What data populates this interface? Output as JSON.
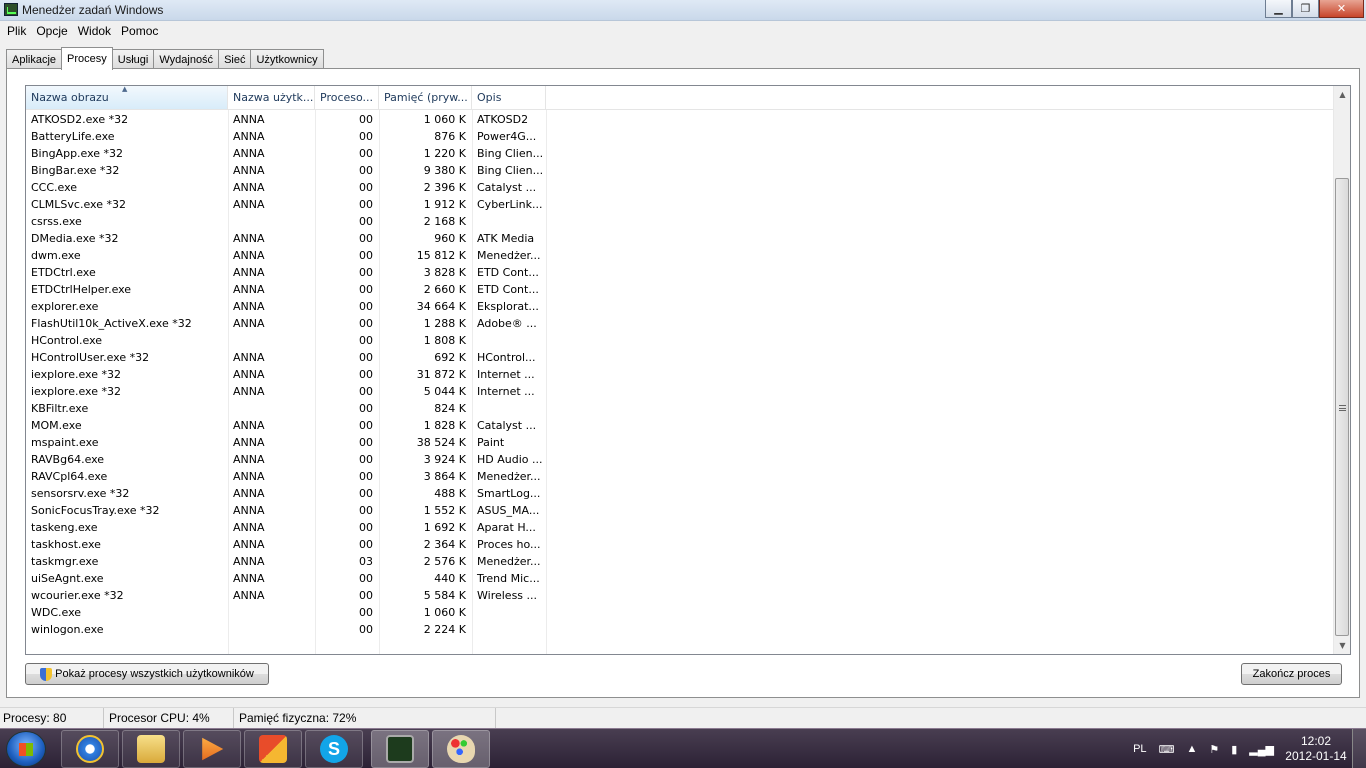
{
  "window": {
    "title": "Menedżer zadań Windows",
    "controls": {
      "minimize": "▁",
      "maximize": "❐",
      "close": "✕"
    }
  },
  "menu": [
    "Plik",
    "Opcje",
    "Widok",
    "Pomoc"
  ],
  "tabs": [
    "Aplikacje",
    "Procesy",
    "Usługi",
    "Wydajność",
    "Sieć",
    "Użytkownicy"
  ],
  "active_tab": "Procesy",
  "columns": [
    "Nazwa obrazu",
    "Nazwa użytk...",
    "Proceso...",
    "Pamięć (pryw...",
    "Opis"
  ],
  "sorted_column": "Nazwa obrazu",
  "processes": [
    {
      "name": "ATKOSD2.exe *32",
      "user": "ANNA",
      "cpu": "00",
      "mem": "1 060 K",
      "desc": "ATKOSD2"
    },
    {
      "name": "BatteryLife.exe",
      "user": "ANNA",
      "cpu": "00",
      "mem": "876 K",
      "desc": "Power4G..."
    },
    {
      "name": "BingApp.exe *32",
      "user": "ANNA",
      "cpu": "00",
      "mem": "1 220 K",
      "desc": "Bing Clien..."
    },
    {
      "name": "BingBar.exe *32",
      "user": "ANNA",
      "cpu": "00",
      "mem": "9 380 K",
      "desc": "Bing Clien..."
    },
    {
      "name": "CCC.exe",
      "user": "ANNA",
      "cpu": "00",
      "mem": "2 396 K",
      "desc": "Catalyst ..."
    },
    {
      "name": "CLMLSvc.exe *32",
      "user": "ANNA",
      "cpu": "00",
      "mem": "1 912 K",
      "desc": "CyberLink..."
    },
    {
      "name": "csrss.exe",
      "user": "",
      "cpu": "00",
      "mem": "2 168 K",
      "desc": ""
    },
    {
      "name": "DMedia.exe *32",
      "user": "ANNA",
      "cpu": "00",
      "mem": "960 K",
      "desc": "ATK Media"
    },
    {
      "name": "dwm.exe",
      "user": "ANNA",
      "cpu": "00",
      "mem": "15 812 K",
      "desc": "Menedżer..."
    },
    {
      "name": "ETDCtrl.exe",
      "user": "ANNA",
      "cpu": "00",
      "mem": "3 828 K",
      "desc": "ETD Cont..."
    },
    {
      "name": "ETDCtrlHelper.exe",
      "user": "ANNA",
      "cpu": "00",
      "mem": "2 660 K",
      "desc": "ETD Cont..."
    },
    {
      "name": "explorer.exe",
      "user": "ANNA",
      "cpu": "00",
      "mem": "34 664 K",
      "desc": "Eksplorat..."
    },
    {
      "name": "FlashUtil10k_ActiveX.exe *32",
      "user": "ANNA",
      "cpu": "00",
      "mem": "1 288 K",
      "desc": "Adobe® ..."
    },
    {
      "name": "HControl.exe",
      "user": "",
      "cpu": "00",
      "mem": "1 808 K",
      "desc": ""
    },
    {
      "name": "HControlUser.exe *32",
      "user": "ANNA",
      "cpu": "00",
      "mem": "692 K",
      "desc": "HControl..."
    },
    {
      "name": "iexplore.exe *32",
      "user": "ANNA",
      "cpu": "00",
      "mem": "31 872 K",
      "desc": "Internet ..."
    },
    {
      "name": "iexplore.exe *32",
      "user": "ANNA",
      "cpu": "00",
      "mem": "5 044 K",
      "desc": "Internet ..."
    },
    {
      "name": "KBFiltr.exe",
      "user": "",
      "cpu": "00",
      "mem": "824 K",
      "desc": ""
    },
    {
      "name": "MOM.exe",
      "user": "ANNA",
      "cpu": "00",
      "mem": "1 828 K",
      "desc": "Catalyst ..."
    },
    {
      "name": "mspaint.exe",
      "user": "ANNA",
      "cpu": "00",
      "mem": "38 524 K",
      "desc": "Paint"
    },
    {
      "name": "RAVBg64.exe",
      "user": "ANNA",
      "cpu": "00",
      "mem": "3 924 K",
      "desc": "HD Audio ..."
    },
    {
      "name": "RAVCpl64.exe",
      "user": "ANNA",
      "cpu": "00",
      "mem": "3 864 K",
      "desc": "Menedżer..."
    },
    {
      "name": "sensorsrv.exe *32",
      "user": "ANNA",
      "cpu": "00",
      "mem": "488 K",
      "desc": "SmartLog..."
    },
    {
      "name": "SonicFocusTray.exe *32",
      "user": "ANNA",
      "cpu": "00",
      "mem": "1 552 K",
      "desc": "ASUS_MA..."
    },
    {
      "name": "taskeng.exe",
      "user": "ANNA",
      "cpu": "00",
      "mem": "1 692 K",
      "desc": "Aparat H..."
    },
    {
      "name": "taskhost.exe",
      "user": "ANNA",
      "cpu": "00",
      "mem": "2 364 K",
      "desc": "Proces ho..."
    },
    {
      "name": "taskmgr.exe",
      "user": "ANNA",
      "cpu": "03",
      "mem": "2 576 K",
      "desc": "Menedżer..."
    },
    {
      "name": "uiSeAgnt.exe",
      "user": "ANNA",
      "cpu": "00",
      "mem": "440 K",
      "desc": "Trend Mic..."
    },
    {
      "name": "wcourier.exe *32",
      "user": "ANNA",
      "cpu": "00",
      "mem": "5 584 K",
      "desc": "Wireless ..."
    },
    {
      "name": "WDC.exe",
      "user": "",
      "cpu": "00",
      "mem": "1 060 K",
      "desc": ""
    },
    {
      "name": "winlogon.exe",
      "user": "",
      "cpu": "00",
      "mem": "2 224 K",
      "desc": ""
    }
  ],
  "buttons": {
    "show_all": "Pokaż procesy wszystkich użytkowników",
    "end_process": "Zakończ proces"
  },
  "status": {
    "processes": "Procesy: 80",
    "cpu": "Procesor CPU: 4%",
    "memory": "Pamięć fizyczna: 72%"
  },
  "taskbar": {
    "apps": [
      "internet-explorer",
      "windows-explorer",
      "media-player",
      "app-installer",
      "skype",
      "task-manager",
      "paint"
    ],
    "language": "PL",
    "time": "12:02",
    "date": "2012-01-14"
  }
}
